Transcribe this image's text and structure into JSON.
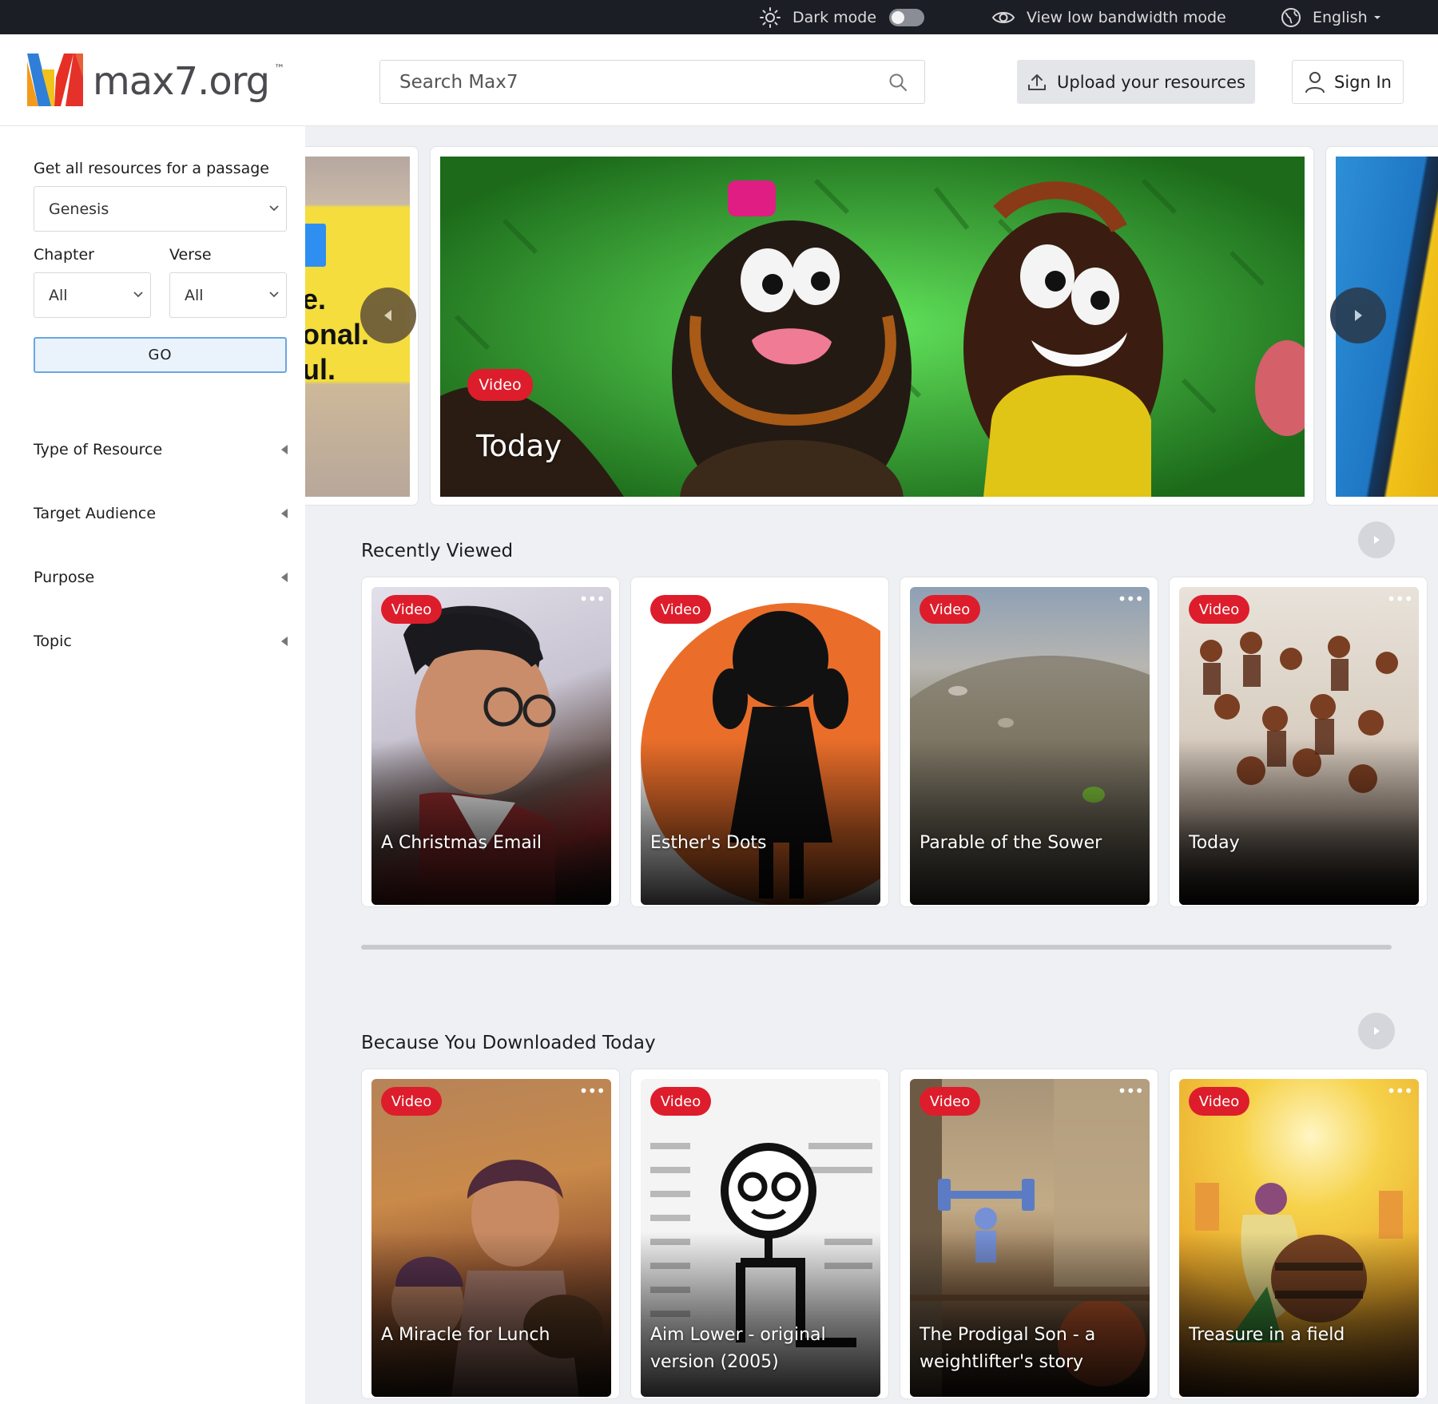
{
  "topbar": {
    "dark_mode_label": "Dark mode",
    "low_bandwidth_label": "View low bandwidth mode",
    "language_label": "English"
  },
  "header": {
    "logo_text": "max7.org",
    "logo_tm": "™",
    "search_placeholder": "Search Max7",
    "upload_label": "Upload your resources",
    "signin_label": "Sign In"
  },
  "sidebar": {
    "passage_label": "Get all resources for a passage",
    "book_value": "Genesis",
    "chapter_label": "Chapter",
    "chapter_value": "All",
    "verse_label": "Verse",
    "verse_value": "All",
    "go_label": "GO",
    "filters": [
      "Type of Resource",
      "Target Audience",
      "Purpose",
      "Topic"
    ]
  },
  "hero": {
    "left_peek_lines": [
      "e.",
      "onal.",
      "ul."
    ],
    "badge": "Video",
    "title": "Today"
  },
  "sections": [
    {
      "title": "Recently Viewed",
      "cards": [
        {
          "badge": "Video",
          "title": "A Christmas Email"
        },
        {
          "badge": "Video",
          "title": "Esther's Dots"
        },
        {
          "badge": "Video",
          "title": "Parable of the Sower"
        },
        {
          "badge": "Video",
          "title": "Today"
        }
      ]
    },
    {
      "title": "Because You Downloaded Today",
      "cards": [
        {
          "badge": "Video",
          "title": "A Miracle for Lunch"
        },
        {
          "badge": "Video",
          "title": "Aim Lower - original version (2005)"
        },
        {
          "badge": "Video",
          "title": "The Prodigal Son - a weightlifter's story"
        },
        {
          "badge": "Video",
          "title": "Treasure in a field"
        }
      ]
    }
  ],
  "colors": {
    "badge_red": "#dd1d2b",
    "topbar_bg": "#1c1e26",
    "go_border": "#6aa7e0",
    "page_bg": "#eef0f4"
  }
}
